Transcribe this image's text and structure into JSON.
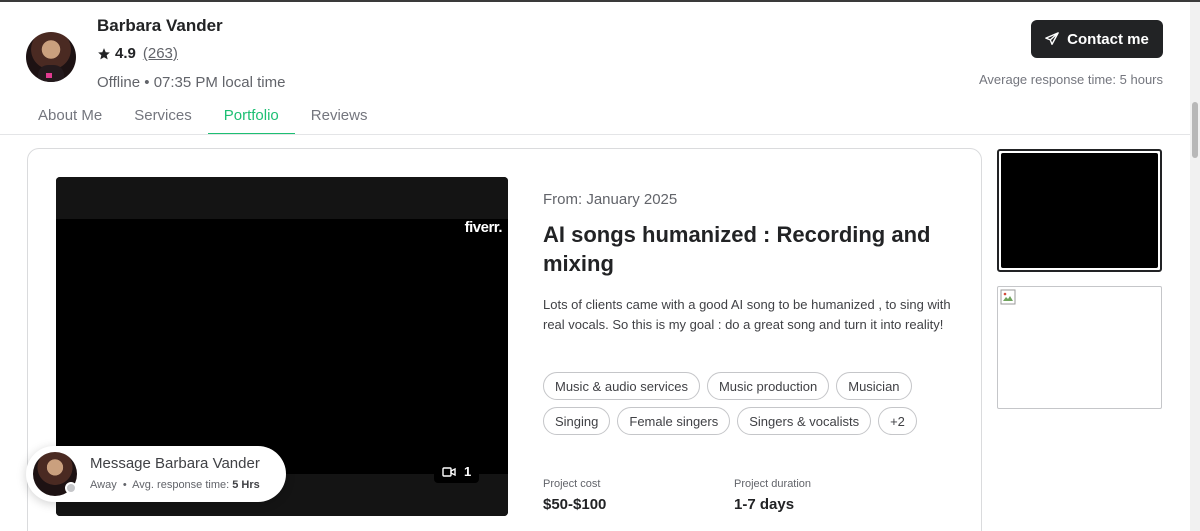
{
  "profile": {
    "name": "Barbara Vander",
    "rating": "4.9",
    "rating_count": "(263)",
    "status": "Offline",
    "local_time": "07:35 PM local time"
  },
  "contact": {
    "button_label": "Contact me",
    "response_time": "Average response time: 5 hours"
  },
  "tabs": [
    {
      "label": "About Me",
      "active": false
    },
    {
      "label": "Services",
      "active": false
    },
    {
      "label": "Portfolio",
      "active": true
    },
    {
      "label": "Reviews",
      "active": false
    }
  ],
  "project": {
    "from": "From: January 2025",
    "title": "AI songs humanized : Recording and mixing",
    "description": "Lots of clients came with a good AI song to be humanized , to sing with real vocals. So this is my goal : do a great song and turn it into reality!",
    "tags": [
      "Music & audio services",
      "Music production",
      "Musician",
      "Singing",
      "Female singers",
      "Singers & vocalists",
      "+2"
    ],
    "cost_label": "Project cost",
    "cost_value": "$50-$100",
    "duration_label": "Project duration",
    "duration_value": "1-7 days",
    "media_watermark": "fiverr.",
    "media_count": "1"
  },
  "message_bubble": {
    "title": "Message Barbara Vander",
    "status": "Away",
    "response_label": "Avg. response time:",
    "response_value": "5 Hrs"
  },
  "colors": {
    "accent": "#1dbf73",
    "dark": "#222325",
    "text": "#404145",
    "muted": "#62646a"
  },
  "icons": [
    "star-icon",
    "send-icon",
    "video-camera-icon",
    "broken-image-icon"
  ]
}
